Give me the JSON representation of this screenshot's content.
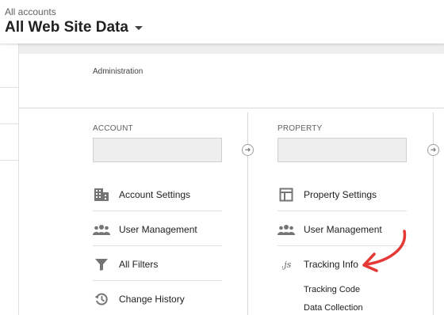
{
  "header": {
    "breadcrumb": "All accounts",
    "title": "All Web Site Data"
  },
  "panel": {
    "heading": "Administration"
  },
  "account": {
    "heading": "ACCOUNT",
    "items": [
      {
        "label": "Account Settings",
        "icon": "building-icon"
      },
      {
        "label": "User Management",
        "icon": "users-icon"
      },
      {
        "label": "All Filters",
        "icon": "filter-icon"
      },
      {
        "label": "Change History",
        "icon": "history-icon"
      }
    ]
  },
  "property": {
    "heading": "PROPERTY",
    "items": [
      {
        "label": "Property Settings",
        "icon": "layout-icon"
      },
      {
        "label": "User Management",
        "icon": "users-icon"
      },
      {
        "label": "Tracking Info",
        "icon": "js-icon",
        "icon_text": ".js"
      }
    ],
    "subitems": [
      "Tracking Code",
      "Data Collection"
    ]
  },
  "colors": {
    "annotation": "#e53935",
    "icon": "#757575"
  }
}
